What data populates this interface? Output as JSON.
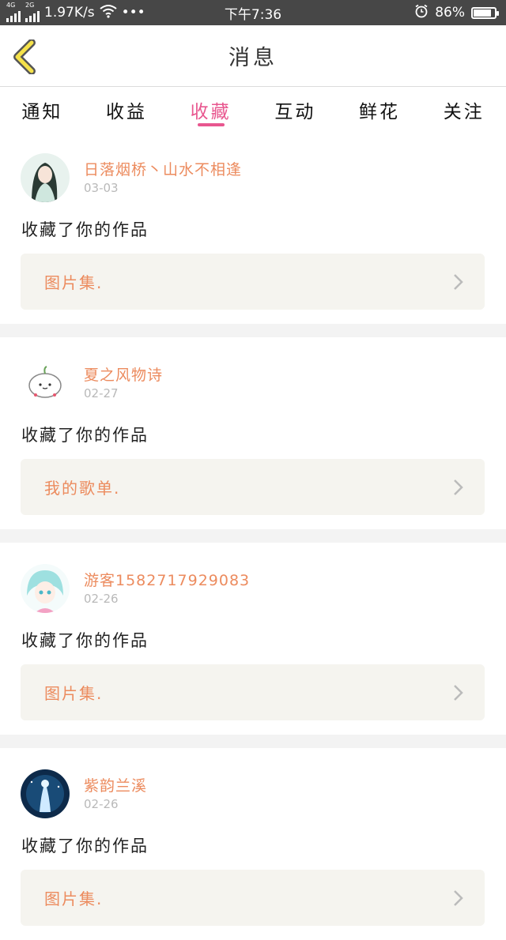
{
  "status_bar": {
    "net_left": "4G",
    "net_right": "2G",
    "speed": "1.97K/s",
    "dots": "•••",
    "time": "下午7:36",
    "battery": "86%",
    "battery_level": 0.86
  },
  "header": {
    "title": "消息"
  },
  "tabs": [
    {
      "label": "通知"
    },
    {
      "label": "收益"
    },
    {
      "label": "收藏"
    },
    {
      "label": "互动"
    },
    {
      "label": "鲜花"
    },
    {
      "label": "关注"
    }
  ],
  "active_tab": "收藏",
  "messages": [
    {
      "user": "日落烟桥丶山水不相逢",
      "date": "03-03",
      "action": "收藏了你的作品",
      "work": "图片集."
    },
    {
      "user": "夏之风物诗",
      "date": "02-27",
      "action": "收藏了你的作品",
      "work": "我的歌单."
    },
    {
      "user": "游客1582717929083",
      "date": "02-26",
      "action": "收藏了你的作品",
      "work": "图片集."
    },
    {
      "user": "紫韵兰溪",
      "date": "02-26",
      "action": "收藏了你的作品",
      "work": "图片集."
    }
  ],
  "colors": {
    "accent": "#e8578f",
    "username": "#ec8b5e",
    "status_bar": "#474747",
    "work_bg": "#f5f4ef"
  }
}
